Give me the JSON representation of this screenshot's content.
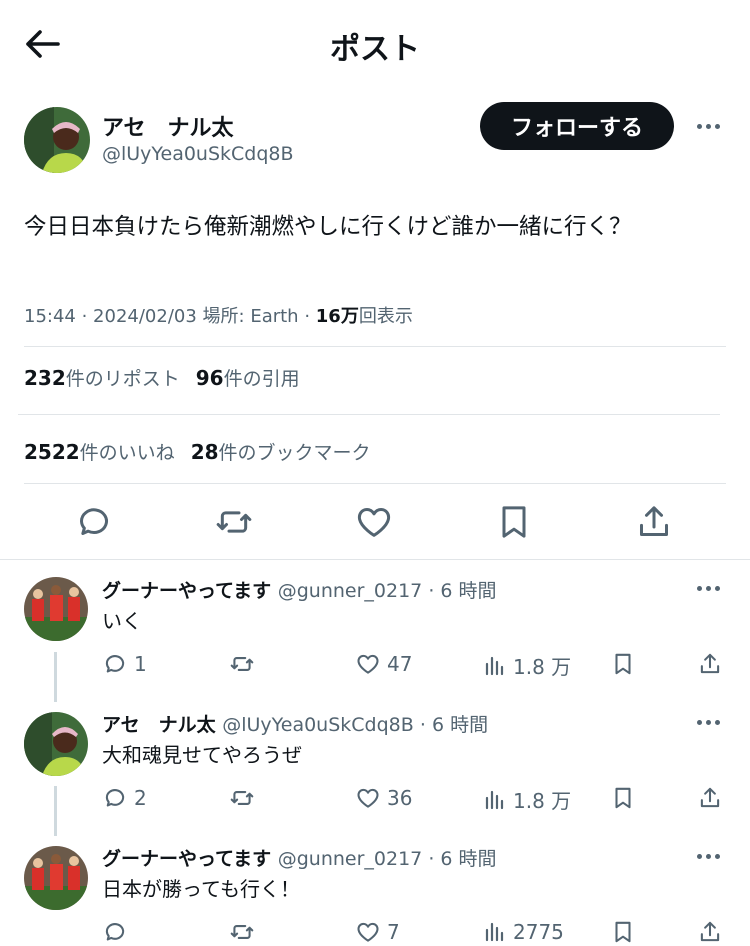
{
  "header": {
    "title": "ポスト"
  },
  "post": {
    "author_name": "アセ　ナル太",
    "author_handle": "@lUyYea0uSkCdq8B",
    "follow_label": "フォローする",
    "text": "今日日本負けたら俺新潮燃やしに行くけど誰か一緒に行く？",
    "time": "15:44",
    "date": "2024/02/03",
    "location_label": "場所: Earth",
    "views": "16万",
    "views_suffix": "回表示",
    "reposts": "232",
    "reposts_label": "件のリポスト",
    "quotes": "96",
    "quotes_label": "件の引用",
    "likes": "2522",
    "likes_label": "件のいいね",
    "bookmarks": "28",
    "bookmarks_label": "件のブックマーク"
  },
  "replies": [
    {
      "name": "グーナーやってます",
      "handle": "@gunner_0217",
      "time": "6 時間",
      "text": "いく",
      "replies": "1",
      "reposts": "",
      "likes": "47",
      "views": "1.8 万"
    },
    {
      "name": "アセ　ナル太",
      "handle": "@lUyYea0uSkCdq8B",
      "time": "6 時間",
      "text": "大和魂見せてやろうぜ",
      "replies": "2",
      "reposts": "",
      "likes": "36",
      "views": "1.8 万"
    },
    {
      "name": "グーナーやってます",
      "handle": "@gunner_0217",
      "time": "6 時間",
      "text": "日本が勝っても行く！",
      "replies": "",
      "reposts": "",
      "likes": "7",
      "views": "2775"
    }
  ],
  "colors": {
    "text": "#0f1419",
    "muted": "#536471",
    "divider": "#e1e5e8",
    "follow_bg": "#0f1419"
  }
}
